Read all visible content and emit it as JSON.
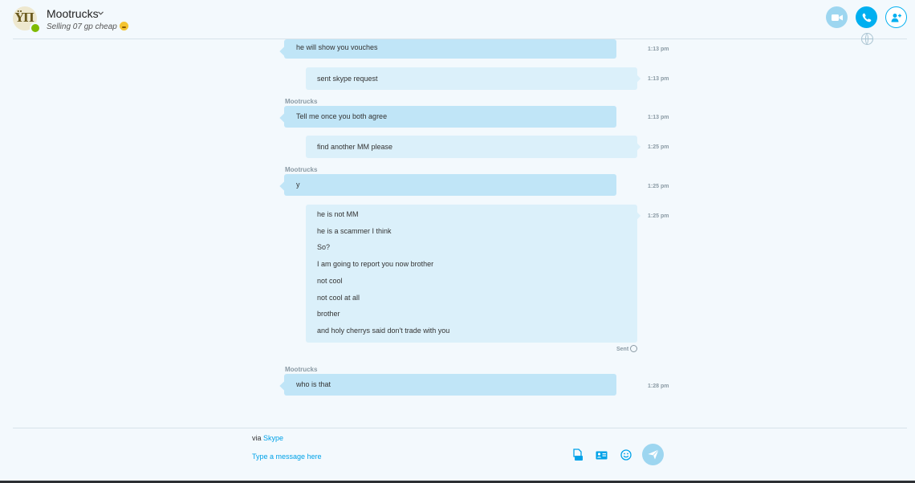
{
  "header": {
    "contact_name": "Mootrucks",
    "mood": "Selling 07 gp cheap",
    "avatar_icon": "contact-avatar-icon",
    "presence_icon": "online-check-icon",
    "buttons": {
      "video_icon": "video-call-icon",
      "call_icon": "phone-call-icon",
      "add_icon": "add-person-icon"
    }
  },
  "conversation": {
    "messages": [
      {
        "direction": "in",
        "sender": "",
        "lines": [
          "he will show you vouches"
        ],
        "time": "1:13 pm"
      },
      {
        "direction": "out",
        "sender": "",
        "lines": [
          "sent skype request"
        ],
        "time": "1:13 pm"
      },
      {
        "direction": "in",
        "sender": "Mootrucks",
        "lines": [
          "Tell me once you both agree"
        ],
        "time": "1:13 pm"
      },
      {
        "direction": "out",
        "sender": "",
        "lines": [
          "find another MM please"
        ],
        "time": "1:25 pm"
      },
      {
        "direction": "in",
        "sender": "Mootrucks",
        "lines": [
          "y"
        ],
        "time": "1:25 pm"
      },
      {
        "direction": "out",
        "sender": "",
        "lines": [
          "he is not MM",
          "he is a scammer I think",
          "So?",
          "I am going to report you now brother",
          "not cool",
          "not cool at all",
          "brother",
          "and holy cherrys said don't trade with you"
        ],
        "time": "1:25 pm"
      },
      {
        "direction": "in",
        "sender": "Mootrucks",
        "lines": [
          "who is that"
        ],
        "time": "1:28 pm"
      }
    ],
    "sent_status": "Sent"
  },
  "composer": {
    "via_prefix": "via",
    "via_link": "Skype",
    "placeholder": "Type a message here",
    "tools": [
      "file-share-icon",
      "contact-card-icon",
      "emoticon-icon",
      "send-icon"
    ]
  },
  "colors": {
    "accent": "#00aff0",
    "incoming_bubble": "#c0e5f7",
    "outgoing_bubble": "#dbf0fa",
    "background": "#f3f9fd"
  }
}
